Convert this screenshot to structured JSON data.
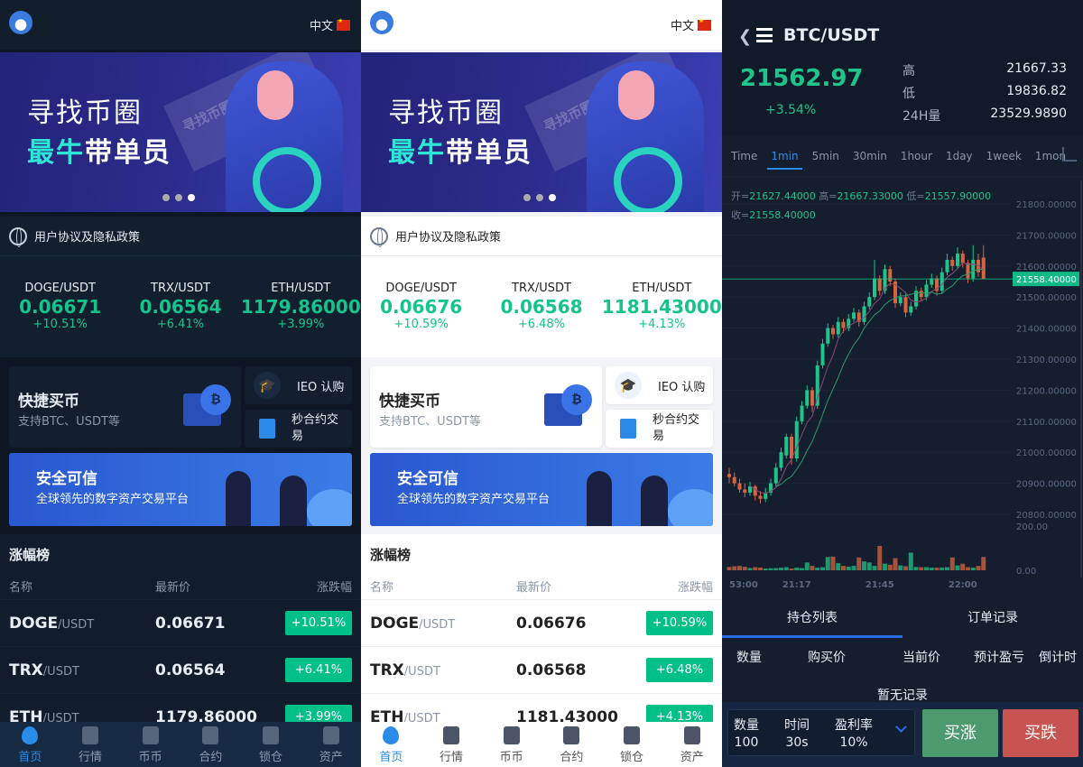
{
  "home_dark": {
    "language": "中文",
    "banner": {
      "line1": "寻找币圈",
      "line2_highlight": "最牛",
      "line2_rest": "带单员",
      "watermark": "寻找币圈最牛带单员"
    },
    "notice": "用户协议及隐私政策",
    "tickers": [
      {
        "pair": "DOGE/USDT",
        "price": "0.06671",
        "change": "+10.51%"
      },
      {
        "pair": "TRX/USDT",
        "price": "0.06564",
        "change": "+6.41%"
      },
      {
        "pair": "ETH/USDT",
        "price": "1179.86000",
        "change": "+3.99%"
      }
    ],
    "quick_buy": {
      "title": "快捷买币",
      "subtitle": "支持BTC、USDT等"
    },
    "ieo": "IEO 认购",
    "second_contract": "秒合约交易",
    "safe_banner": {
      "title": "安全可信",
      "subtitle": "全球领先的数字资产交易平台"
    },
    "ranking": {
      "title": "涨幅榜",
      "headers": [
        "名称",
        "最新价",
        "涨跌幅"
      ],
      "rows": [
        {
          "base": "DOGE",
          "quote": "/USDT",
          "price": "0.06671",
          "change": "+10.51%"
        },
        {
          "base": "TRX",
          "quote": "/USDT",
          "price": "0.06564",
          "change": "+6.41%"
        },
        {
          "base": "ETH",
          "quote": "/USDT",
          "price": "1179.86000",
          "change": "+3.99%"
        }
      ]
    },
    "nav": [
      {
        "label": "首页",
        "icon": "flame-icon",
        "active": true
      },
      {
        "label": "行情",
        "icon": "chart-icon"
      },
      {
        "label": "币币",
        "icon": "exchange-icon"
      },
      {
        "label": "合约",
        "icon": "contract-icon"
      },
      {
        "label": "锁仓",
        "icon": "lock-icon"
      },
      {
        "label": "资产",
        "icon": "wallet-icon"
      }
    ]
  },
  "home_light": {
    "language": "中文",
    "banner": {
      "line1": "寻找币圈",
      "line2_highlight": "最牛",
      "line2_rest": "带单员",
      "watermark": "寻找币圈最牛带单员"
    },
    "notice": "用户协议及隐私政策",
    "tickers": [
      {
        "pair": "DOGE/USDT",
        "price": "0.06676",
        "change": "+10.59%"
      },
      {
        "pair": "TRX/USDT",
        "price": "0.06568",
        "change": "+6.48%"
      },
      {
        "pair": "ETH/USDT",
        "price": "1181.43000",
        "change": "+4.13%"
      }
    ],
    "quick_buy": {
      "title": "快捷买币",
      "subtitle": "支持BTC、USDT等"
    },
    "ieo": "IEO 认购",
    "second_contract": "秒合约交易",
    "safe_banner": {
      "title": "安全可信",
      "subtitle": "全球领先的数字资产交易平台"
    },
    "ranking": {
      "title": "涨幅榜",
      "headers": [
        "名称",
        "最新价",
        "涨跌幅"
      ],
      "rows": [
        {
          "base": "DOGE",
          "quote": "/USDT",
          "price": "0.06676",
          "change": "+10.59%"
        },
        {
          "base": "TRX",
          "quote": "/USDT",
          "price": "0.06568",
          "change": "+6.48%"
        },
        {
          "base": "ETH",
          "quote": "/USDT",
          "price": "1181.43000",
          "change": "+4.13%"
        }
      ]
    },
    "nav": [
      {
        "label": "首页",
        "icon": "flame-icon",
        "active": true
      },
      {
        "label": "行情",
        "icon": "chart-icon"
      },
      {
        "label": "币币",
        "icon": "exchange-icon"
      },
      {
        "label": "合约",
        "icon": "contract-icon"
      },
      {
        "label": "锁仓",
        "icon": "lock-icon"
      },
      {
        "label": "资产",
        "icon": "wallet-icon"
      }
    ]
  },
  "trade": {
    "pair": "BTC/USDT",
    "price": "21562.97",
    "change": "+3.54%",
    "stats": [
      {
        "label": "高",
        "value": "21667.33"
      },
      {
        "label": "低",
        "value": "19836.82"
      },
      {
        "label": "24H量",
        "value": "23529.9890"
      }
    ],
    "intervals": [
      "Time",
      "1min",
      "5min",
      "30min",
      "1hour",
      "1day",
      "1week",
      "1mon"
    ],
    "active_interval": "1min",
    "ohlc": {
      "open_label": "开=",
      "open": "21627.44000",
      "high_label": "高=",
      "high": "21667.33000",
      "low_label": "低=",
      "low": "21557.90000",
      "close_label": "收=",
      "close": "21558.40000"
    },
    "position_tabs": [
      "持仓列表",
      "订单记录"
    ],
    "columns": [
      "数量",
      "购买价",
      "当前价",
      "预计盈亏",
      "倒计时"
    ],
    "empty": "暂无记录",
    "order": {
      "qty_label": "数量",
      "qty": "100",
      "time_label": "时间",
      "time": "30s",
      "rate_label": "盈利率",
      "rate": "10%"
    },
    "buy_up": "买涨",
    "buy_down": "买跌"
  },
  "colors": {
    "up": "#1ec48a",
    "down": "#d8643f",
    "accent": "#2a8ce8",
    "ma1": "#8a4a78",
    "ma2": "#2f9a6a"
  },
  "chart_data": {
    "type": "candlestick",
    "y_ticks": [
      "21800.00000",
      "21700.00000",
      "21600.00000",
      "21500.00000",
      "21400.00000",
      "21300.00000",
      "21200.00000",
      "21100.00000",
      "21000.00000",
      "20900.00000",
      "20800.00000"
    ],
    "ylim": [
      20800,
      21800
    ],
    "last_price_label": "21558.40000",
    "last_price": 21558.4,
    "volume_ticks": [
      "200.00",
      "0.00"
    ],
    "volume_lim": [
      0,
      200
    ],
    "x_ticks": [
      {
        "label": "53:00",
        "index": 0
      },
      {
        "label": "21:17",
        "index": 13
      },
      {
        "label": "21:45",
        "index": 29
      },
      {
        "label": "22:00",
        "index": 45
      }
    ],
    "candles": [
      [
        20930,
        20950,
        20900,
        20920
      ],
      [
        20920,
        20935,
        20890,
        20900
      ],
      [
        20900,
        20915,
        20870,
        20880
      ],
      [
        20880,
        20900,
        20855,
        20870
      ],
      [
        20870,
        20905,
        20860,
        20890
      ],
      [
        20890,
        20895,
        20845,
        20860
      ],
      [
        20860,
        20875,
        20835,
        20850
      ],
      [
        20850,
        20885,
        20840,
        20870
      ],
      [
        20870,
        20915,
        20860,
        20900
      ],
      [
        20900,
        20965,
        20890,
        20950
      ],
      [
        20950,
        21015,
        20940,
        21000
      ],
      [
        20990,
        21060,
        20980,
        21050
      ],
      [
        21050,
        21060,
        20960,
        20980
      ],
      [
        20980,
        21115,
        20970,
        21100
      ],
      [
        21100,
        21165,
        21090,
        21150
      ],
      [
        21150,
        21215,
        21140,
        21200
      ],
      [
        21200,
        21210,
        21130,
        21150
      ],
      [
        21150,
        21295,
        21140,
        21280
      ],
      [
        21280,
        21365,
        21270,
        21350
      ],
      [
        21350,
        21415,
        21340,
        21400
      ],
      [
        21400,
        21410,
        21365,
        21380
      ],
      [
        21380,
        21435,
        21370,
        21420
      ],
      [
        21420,
        21430,
        21385,
        21400
      ],
      [
        21400,
        21445,
        21390,
        21430
      ],
      [
        21430,
        21465,
        21420,
        21450
      ],
      [
        21450,
        21460,
        21405,
        21420
      ],
      [
        21420,
        21485,
        21410,
        21470
      ],
      [
        21470,
        21515,
        21460,
        21500
      ],
      [
        21500,
        21620,
        21490,
        21560
      ],
      [
        21560,
        21570,
        21505,
        21520
      ],
      [
        21520,
        21605,
        21510,
        21590
      ],
      [
        21590,
        21600,
        21535,
        21550
      ],
      [
        21550,
        21560,
        21465,
        21480
      ],
      [
        21480,
        21515,
        21470,
        21500
      ],
      [
        21500,
        21510,
        21435,
        21450
      ],
      [
        21450,
        21485,
        21440,
        21470
      ],
      [
        21470,
        21535,
        21460,
        21520
      ],
      [
        21520,
        21530,
        21485,
        21500
      ],
      [
        21500,
        21555,
        21490,
        21540
      ],
      [
        21540,
        21575,
        21530,
        21560
      ],
      [
        21560,
        21570,
        21505,
        21520
      ],
      [
        21520,
        21595,
        21510,
        21580
      ],
      [
        21580,
        21640,
        21570,
        21620
      ],
      [
        21620,
        21630,
        21585,
        21600
      ],
      [
        21600,
        21660,
        21590,
        21640
      ],
      [
        21640,
        21650,
        21595,
        21610
      ],
      [
        21610,
        21620,
        21545,
        21560
      ],
      [
        21560,
        21667,
        21550,
        21620
      ],
      [
        21620,
        21640,
        21565,
        21580
      ],
      [
        21627,
        21667,
        21557,
        21558
      ]
    ],
    "volumes": [
      15,
      18,
      20,
      16,
      10,
      14,
      12,
      8,
      9,
      10,
      12,
      14,
      8,
      12,
      10,
      35,
      20,
      12,
      14,
      60,
      62,
      32,
      20,
      16,
      20,
      58,
      40,
      35,
      20,
      110,
      30,
      25,
      55,
      22,
      18,
      80,
      15,
      14,
      14,
      12,
      12,
      12,
      14,
      58,
      22,
      30,
      14,
      12,
      20,
      60
    ]
  }
}
